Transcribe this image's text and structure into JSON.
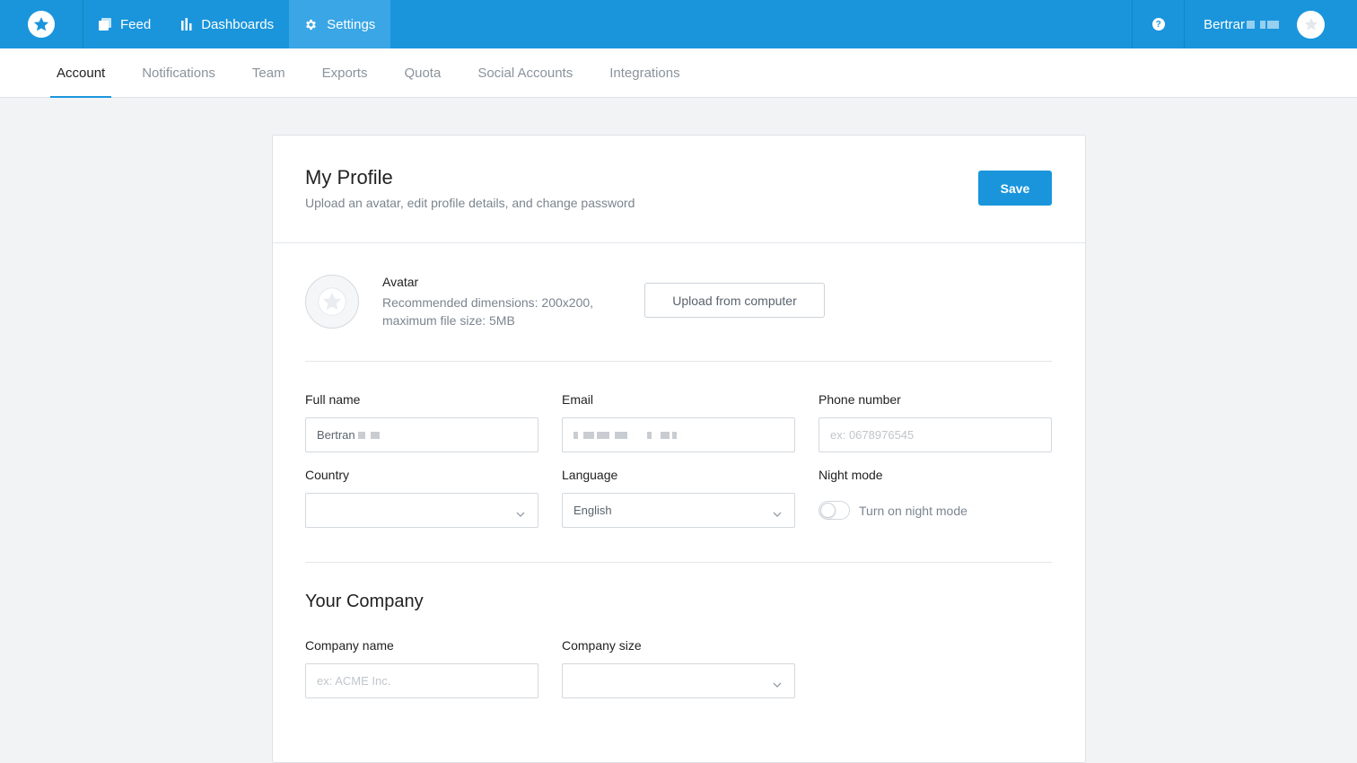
{
  "topbar": {
    "logo_icon": "star-logo-icon",
    "nav": [
      {
        "label": "Feed",
        "icon": "feed-icon"
      },
      {
        "label": "Dashboards",
        "icon": "bar-chart-icon"
      },
      {
        "label": "Settings",
        "icon": "gear-icon",
        "active": true
      }
    ],
    "help_glyph": "?",
    "user_name": "Bertrar",
    "accent_color": "#1a95dc"
  },
  "subnav": {
    "tabs": [
      {
        "label": "Account",
        "active": true
      },
      {
        "label": "Notifications"
      },
      {
        "label": "Team"
      },
      {
        "label": "Exports"
      },
      {
        "label": "Quota"
      },
      {
        "label": "Social Accounts"
      },
      {
        "label": "Integrations"
      }
    ]
  },
  "profile": {
    "title": "My Profile",
    "subtitle": "Upload an avatar, edit profile details, and change password",
    "save_label": "Save",
    "avatar": {
      "title": "Avatar",
      "description": "Recommended dimensions: 200x200, maximum file size: 5MB",
      "upload_label": "Upload from computer"
    },
    "fields": {
      "full_name": {
        "label": "Full name",
        "value": "Bertran"
      },
      "email": {
        "label": "Email",
        "value": ""
      },
      "phone": {
        "label": "Phone number",
        "placeholder": "ex: 0678976545"
      },
      "country": {
        "label": "Country",
        "value": ""
      },
      "language": {
        "label": "Language",
        "value": "English"
      },
      "night_mode": {
        "label": "Night mode",
        "toggle_label": "Turn on night mode",
        "enabled": false
      }
    }
  },
  "company": {
    "title": "Your Company",
    "fields": {
      "company_name": {
        "label": "Company name",
        "placeholder": "ex: ACME Inc."
      },
      "company_size": {
        "label": "Company size",
        "value": ""
      }
    }
  }
}
